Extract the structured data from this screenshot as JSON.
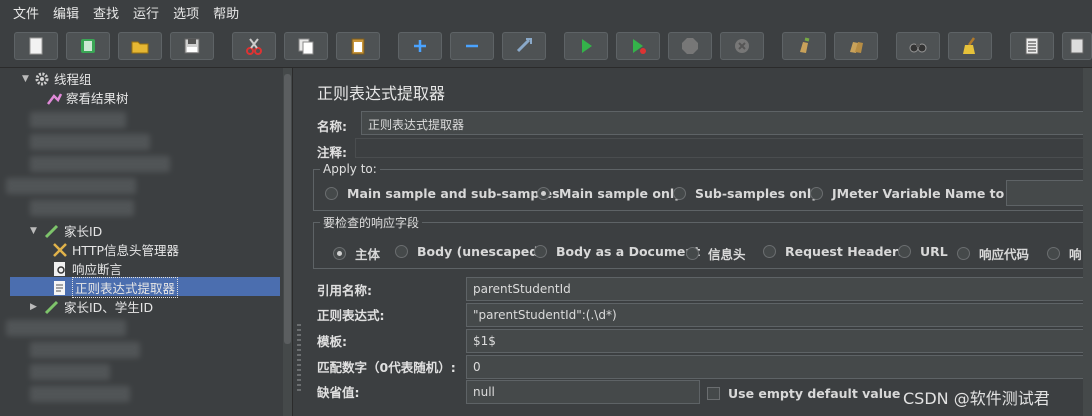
{
  "menu": [
    "文件",
    "编辑",
    "查找",
    "运行",
    "选项",
    "帮助"
  ],
  "toolbar": [
    {
      "icon": "new-icon"
    },
    {
      "icon": "templates-icon"
    },
    {
      "icon": "open-icon"
    },
    {
      "icon": "save-icon"
    },
    {
      "icon": "cut-icon"
    },
    {
      "icon": "copy-icon"
    },
    {
      "icon": "paste-icon"
    },
    {
      "icon": "expand-icon"
    },
    {
      "icon": "collapse-icon"
    },
    {
      "icon": "toggle-icon"
    },
    {
      "icon": "start-icon"
    },
    {
      "icon": "start-no-pause-icon"
    },
    {
      "icon": "stop-icon"
    },
    {
      "icon": "shutdown-icon"
    },
    {
      "icon": "clear-icon"
    },
    {
      "icon": "clear-all-icon"
    },
    {
      "icon": "search-icon"
    },
    {
      "icon": "reset-search-icon"
    },
    {
      "icon": "function-helper-icon"
    },
    {
      "icon": "help-icon"
    }
  ],
  "tree": {
    "root": "线程组",
    "listener": "察看结果树",
    "group1": "家长ID",
    "header_manager": "HTTP信息头管理器",
    "assertion": "响应断言",
    "extractor": "正则表达式提取器",
    "group2": "家长ID、学生ID"
  },
  "panel": {
    "title": "正则表达式提取器",
    "name_label": "名称:",
    "name_value": "正则表达式提取器",
    "comment_label": "注释:",
    "apply_to": {
      "legend": "Apply to:",
      "options": [
        "Main sample and sub-samples",
        "Main sample only",
        "Sub-samples only",
        "JMeter Variable Name to use"
      ],
      "selected": "Main sample only"
    },
    "check_field": {
      "legend": "要检查的响应字段",
      "options": [
        "主体",
        "Body (unescaped)",
        "Body as a Document",
        "信息头",
        "Request Headers",
        "URL",
        "响应代码",
        "响"
      ],
      "selected": "主体"
    },
    "ref_name_label": "引用名称:",
    "ref_name_value": "parentStudentId",
    "regex_label": "正则表达式:",
    "regex_value": "\"parentStudentId\":(.\\d*)",
    "template_label": "模板:",
    "template_value": "$1$",
    "match_label": "匹配数字（0代表随机）:",
    "match_value": "0",
    "default_label": "缺省值:",
    "default_value": "null",
    "empty_default_label": "Use empty default value"
  },
  "watermark": "CSDN @软件测试君"
}
